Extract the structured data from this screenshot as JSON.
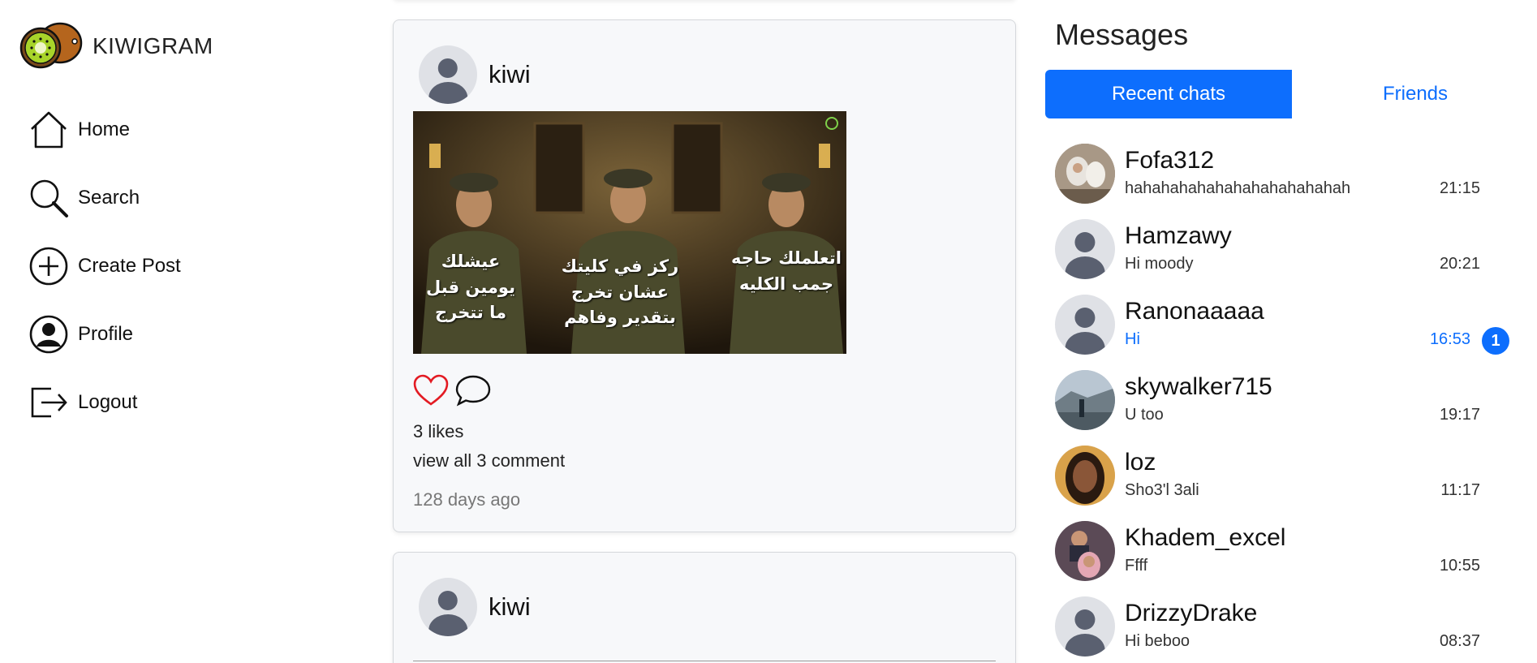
{
  "app": {
    "name": "KIWIGRAM"
  },
  "nav": {
    "items": [
      {
        "label": "Home",
        "icon": "home-icon"
      },
      {
        "label": "Search",
        "icon": "search-icon"
      },
      {
        "label": "Create Post",
        "icon": "plus-circle-icon"
      },
      {
        "label": "Profile",
        "icon": "user-circle-icon"
      },
      {
        "label": "Logout",
        "icon": "logout-icon"
      }
    ]
  },
  "feed": {
    "posts": [
      {
        "username": "kiwi",
        "image": {
          "captions": [
            "عيشلك يومين قبل ما تتخرج",
            "ركز في كليتك عشان تخرج بتقدير وفاهم",
            "اتعلملك حاجه جمب الكليه"
          ]
        },
        "likes": "3 likes",
        "comments_link": "view all 3 comment",
        "time": "128 days ago"
      },
      {
        "username": "kiwi"
      }
    ]
  },
  "messages": {
    "title": "Messages",
    "tabs": {
      "recent": "Recent chats",
      "friends": "Friends"
    },
    "chats": [
      {
        "name": "Fofa312",
        "last": "hahahahahahahahahahahahah",
        "time": "21:15",
        "avatar": "photo"
      },
      {
        "name": "Hamzawy",
        "last": "Hi moody",
        "time": "20:21",
        "avatar": "default"
      },
      {
        "name": "Ranonaaaaa",
        "last": "Hi",
        "time": "16:53",
        "avatar": "default",
        "unread": "1"
      },
      {
        "name": "skywalker715",
        "last": "U too",
        "time": "19:17",
        "avatar": "photo"
      },
      {
        "name": "loz",
        "last": "Sho3'l 3ali",
        "time": "11:17",
        "avatar": "photo"
      },
      {
        "name": "Khadem_excel",
        "last": "Ffff",
        "time": "10:55",
        "avatar": "photo"
      },
      {
        "name": "DrizzyDrake",
        "last": "Hi beboo",
        "time": "08:37",
        "avatar": "default"
      }
    ]
  },
  "colors": {
    "accent": "#0d6efd",
    "like": "#e31b23",
    "card_bg": "#f7f8fa"
  }
}
